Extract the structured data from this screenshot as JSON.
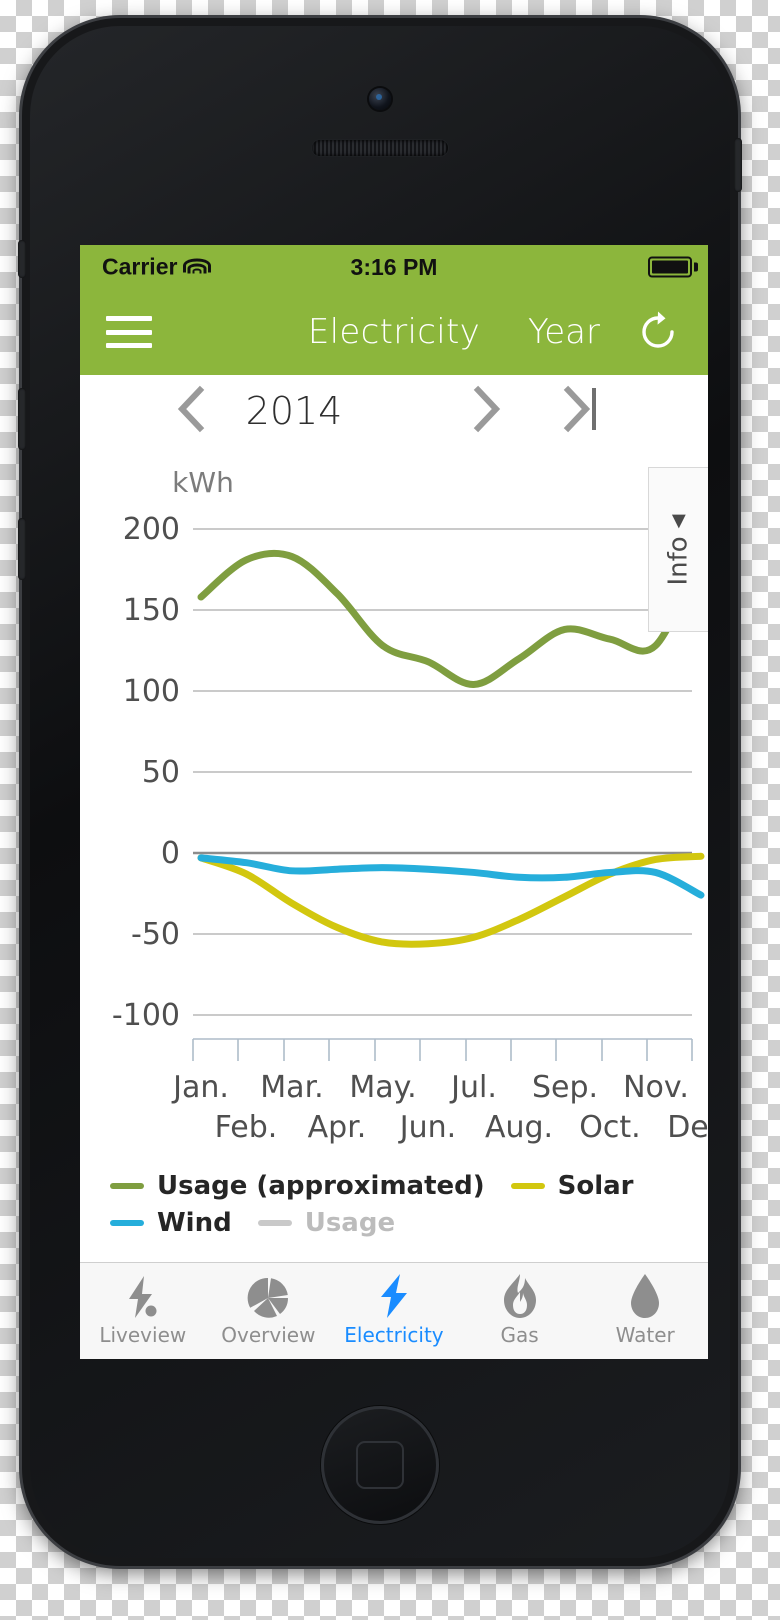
{
  "status_bar": {
    "carrier": "Carrier",
    "wifi_icon": "wifi-icon",
    "time": "3:16 PM",
    "battery_icon": "battery-full-icon"
  },
  "nav_bar": {
    "menu_icon": "hamburger-menu-icon",
    "title": "Electricity",
    "period": "Year",
    "refresh_icon": "refresh-icon",
    "background_color": "#8cb63c"
  },
  "date_selector": {
    "prev_icon": "chevron-left-icon",
    "year": "2014",
    "next_icon": "chevron-right-icon",
    "last_icon": "chevron-right-bar-icon"
  },
  "info_panel": {
    "label": "Info",
    "caret_icon": "caret-left-icon"
  },
  "legend": [
    {
      "label": "Usage (approximated)",
      "color": "#7f9e40",
      "muted": false
    },
    {
      "label": "Solar",
      "color": "#d2c70f",
      "muted": false
    },
    {
      "label": "Wind",
      "color": "#26aedb",
      "muted": false
    },
    {
      "label": "Usage",
      "color": "#c9c9c9",
      "muted": true
    }
  ],
  "tab_bar": {
    "items": [
      {
        "label": "Liveview",
        "icon": "lightning-dot-icon",
        "active": false
      },
      {
        "label": "Overview",
        "icon": "pie-chart-icon",
        "active": false
      },
      {
        "label": "Electricity",
        "icon": "lightning-bolt-icon",
        "active": true
      },
      {
        "label": "Gas",
        "icon": "flame-icon",
        "active": false
      },
      {
        "label": "Water",
        "icon": "water-drop-icon",
        "active": false
      }
    ],
    "active_color": "#1a8cff",
    "inactive_color": "#8e8e8e"
  },
  "chart_data": {
    "type": "line",
    "title": "",
    "xlabel": "",
    "ylabel": "kWh",
    "unit": "kWh",
    "ylim": [
      -100,
      200
    ],
    "yticks": [
      200,
      150,
      100,
      50,
      0,
      -50,
      -100
    ],
    "ytick_labels": [
      "200",
      "150",
      "100",
      "50",
      "0",
      "-50",
      "-100"
    ],
    "grid": true,
    "legend_position": "bottom-left",
    "categories": [
      "Jan.",
      "Feb.",
      "Mar.",
      "Apr.",
      "May.",
      "Jun.",
      "Jul.",
      "Aug.",
      "Sep.",
      "Oct.",
      "Nov.",
      "Dec."
    ],
    "series": [
      {
        "name": "Usage (approximated)",
        "color": "#7f9e40",
        "values": [
          158,
          181,
          183,
          160,
          128,
          118,
          104,
          120,
          138,
          132,
          128,
          185
        ]
      },
      {
        "name": "Solar",
        "color": "#d2c70f",
        "values": [
          -3,
          -13,
          -31,
          -46,
          -55,
          -56,
          -52,
          -41,
          -27,
          -13,
          -4,
          -2
        ]
      },
      {
        "name": "Wind",
        "color": "#26aedb",
        "values": [
          -3,
          -6,
          -11,
          -10,
          -9,
          -10,
          -12,
          -15,
          -15,
          -12,
          -12,
          -26
        ]
      },
      {
        "name": "Usage",
        "color": "#c9c9c9",
        "values": []
      }
    ]
  }
}
